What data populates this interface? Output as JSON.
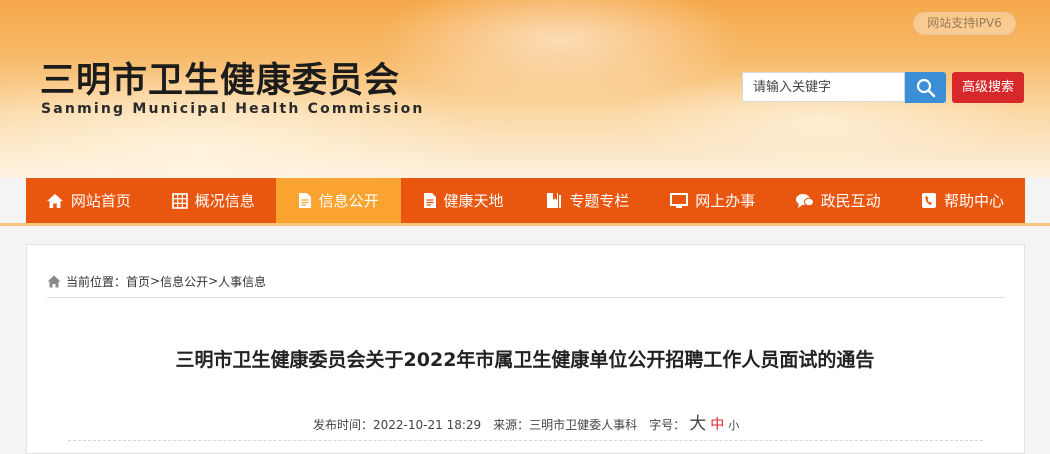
{
  "header": {
    "title": "三明市卫生健康委员会",
    "subtitle": "Sanming Municipal Health Commission",
    "ipv6_badge": "网站支持IPV6",
    "search": {
      "placeholder": "请输入关键字",
      "value": "",
      "button_icon": "search-icon"
    },
    "advanced_search_label": "高级搜索"
  },
  "nav": {
    "active_index": 2,
    "items": [
      {
        "label": "网站首页",
        "icon": "home-icon"
      },
      {
        "label": "概况信息",
        "icon": "grid-icon"
      },
      {
        "label": "信息公开",
        "icon": "document-icon"
      },
      {
        "label": "健康天地",
        "icon": "document-icon"
      },
      {
        "label": "专题专栏",
        "icon": "bookmark-icon"
      },
      {
        "label": "网上办事",
        "icon": "monitor-icon"
      },
      {
        "label": "政民互动",
        "icon": "chat-icon"
      },
      {
        "label": "帮助中心",
        "icon": "phone-icon"
      }
    ]
  },
  "breadcrumb": {
    "prefix": "当前位置：",
    "items": [
      "首页",
      "信息公开",
      "人事信息"
    ],
    "separator": ">"
  },
  "article": {
    "title": "三明市卫生健康委员会关于2022年市属卫生健康单位公开招聘工作人员面试的通告",
    "publish_label": "发布时间：",
    "publish_time": "2022-10-21 18:29",
    "source_label": "来源：",
    "source": "三明市卫健委人事科",
    "font_size_label": "字号：",
    "font_sizes": [
      "大",
      "中",
      "小"
    ]
  },
  "colors": {
    "nav_bg": "#e8560f",
    "nav_active": "#fba331",
    "search_button": "#3a8fd7",
    "advanced_button": "#d7282b"
  }
}
